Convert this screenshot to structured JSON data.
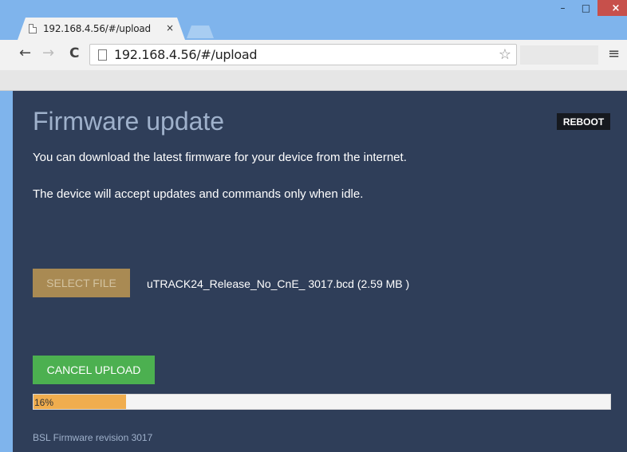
{
  "browser": {
    "tab": {
      "title": "192.168.4.56/#/upload",
      "close_glyph": "×"
    },
    "address": {
      "url": "192.168.4.56/#/upload"
    },
    "icons": {
      "back": "←",
      "forward": "→",
      "reload": "C",
      "star": "☆",
      "menu": "≡",
      "minimize": "–",
      "maximize": "□",
      "close": "×"
    }
  },
  "page": {
    "title": "Firmware update",
    "reboot_label": "REBOOT",
    "intro_text": "You can download the latest firmware for your device from the internet.",
    "idle_text": "The device will accept updates and commands only when idle.",
    "select_file_label": "SELECT FILE",
    "file_name": "uTRACK24_Release_No_CnE_ 3017.bcd (2.59 MB )",
    "cancel_upload_label": "CANCEL UPLOAD",
    "progress": {
      "value": 0.16,
      "label": "16%"
    },
    "footer": "BSL Firmware revision 3017"
  },
  "colors": {
    "page_bg": "#2f3e59",
    "title": "#9fb1cb",
    "select_button": "#a98a53",
    "cancel_button": "#4cb050",
    "progress_fill": "#f0ad4e",
    "reboot_button": "#16191f"
  }
}
